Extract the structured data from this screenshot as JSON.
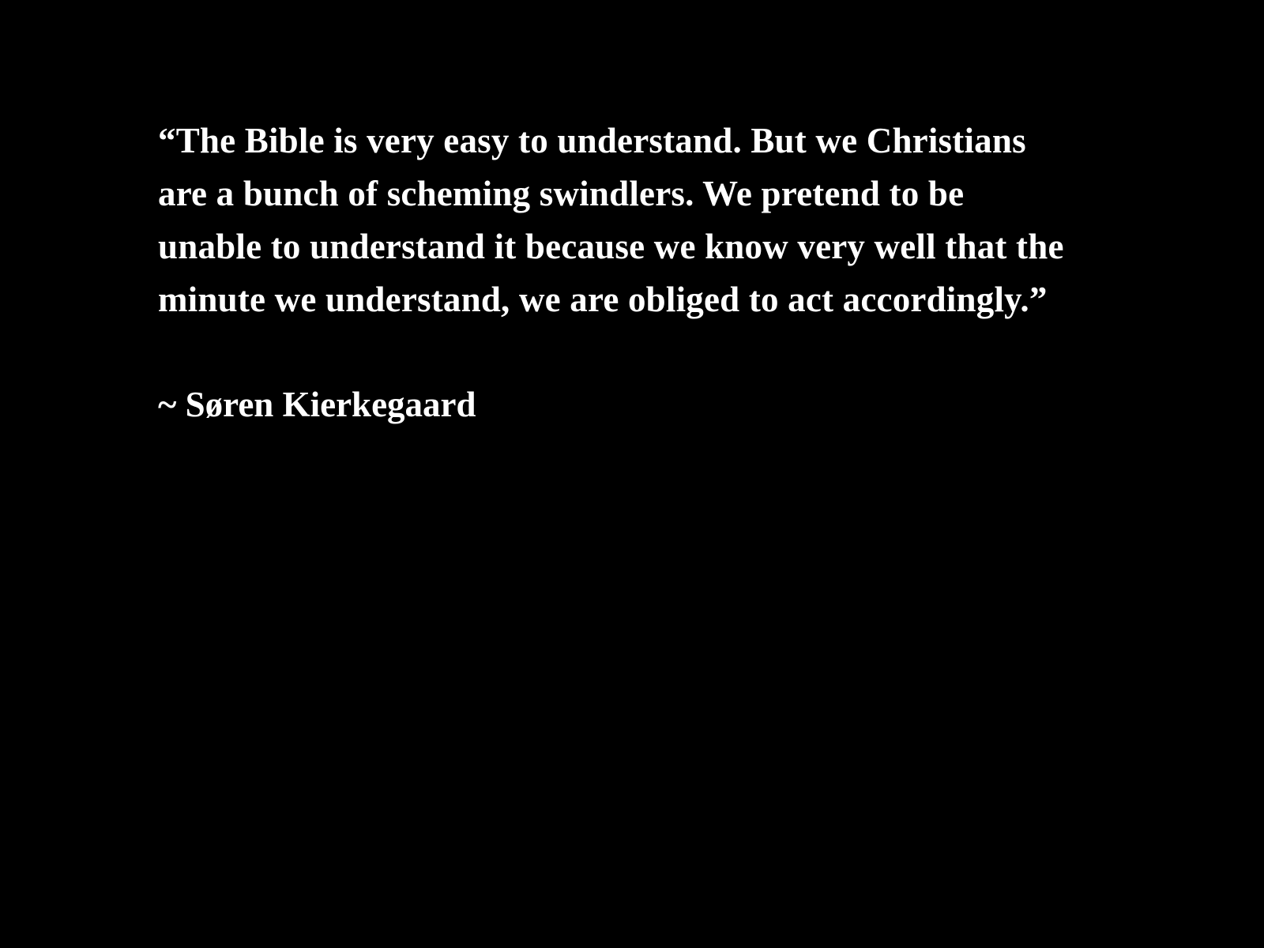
{
  "slide": {
    "quote": "“The Bible is very easy to understand. But we Christians are a bunch of scheming swindlers. We pretend to be unable to understand it because we know very well that the minute we understand, we are obliged to act accordingly.”",
    "attribution": "~ Søren Kierkegaard"
  },
  "colors": {
    "background": "#000000",
    "text": "#ffffff"
  }
}
